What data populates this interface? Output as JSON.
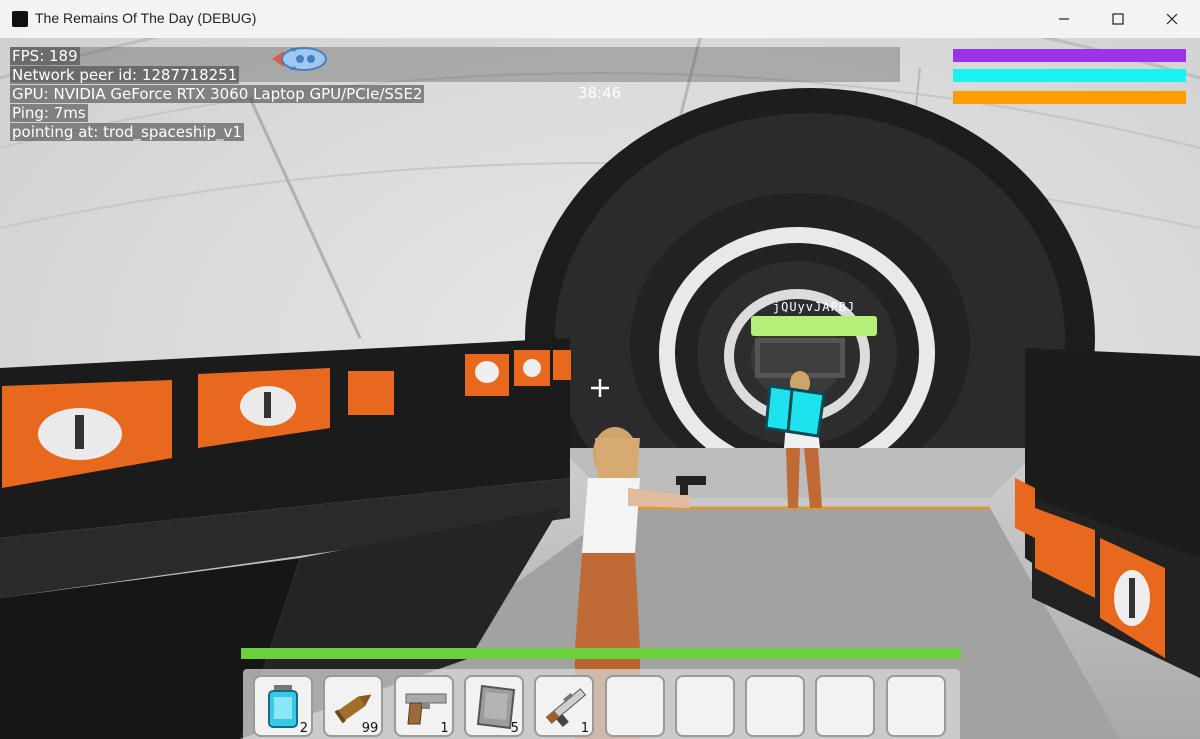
{
  "window": {
    "title": "The Remains Of The Day (DEBUG)",
    "controls": [
      "minimize",
      "maximize",
      "close"
    ]
  },
  "debug": {
    "fps": "FPS: 189",
    "peer_id": "Network peer id: 1287718251",
    "gpu": "GPU: NVIDIA GeForce RTX 3060 Laptop GPU/PCIe/SSE2",
    "ping": "Ping: 7ms",
    "pointing_at": "pointing at: trod_spaceship_v1"
  },
  "hud": {
    "clock": "38:46",
    "status_bars": [
      {
        "color": "#9b32ec",
        "level": 1.0
      },
      {
        "color": "#19f3ee",
        "level": 1.0
      },
      {
        "color": "#ff9d00",
        "level": 1.0
      }
    ],
    "other_player": {
      "name": "jQUyvJAPBJ",
      "health_level": 1.0,
      "health_color": "#b6ee7a"
    },
    "player_health": {
      "level": 1.0,
      "color": "#6ccf3c"
    },
    "spaceship_icon": "rocket-icon"
  },
  "hotbar": {
    "slots": [
      {
        "item": "battery-icon",
        "count": "2"
      },
      {
        "item": "bullet-icon",
        "count": "99"
      },
      {
        "item": "pistol-icon",
        "count": "1"
      },
      {
        "item": "metal-plate-icon",
        "count": "5"
      },
      {
        "item": "rifle-icon",
        "count": "1"
      },
      {
        "item": "",
        "count": ""
      },
      {
        "item": "",
        "count": ""
      },
      {
        "item": "",
        "count": ""
      },
      {
        "item": "",
        "count": ""
      },
      {
        "item": "",
        "count": ""
      }
    ]
  }
}
